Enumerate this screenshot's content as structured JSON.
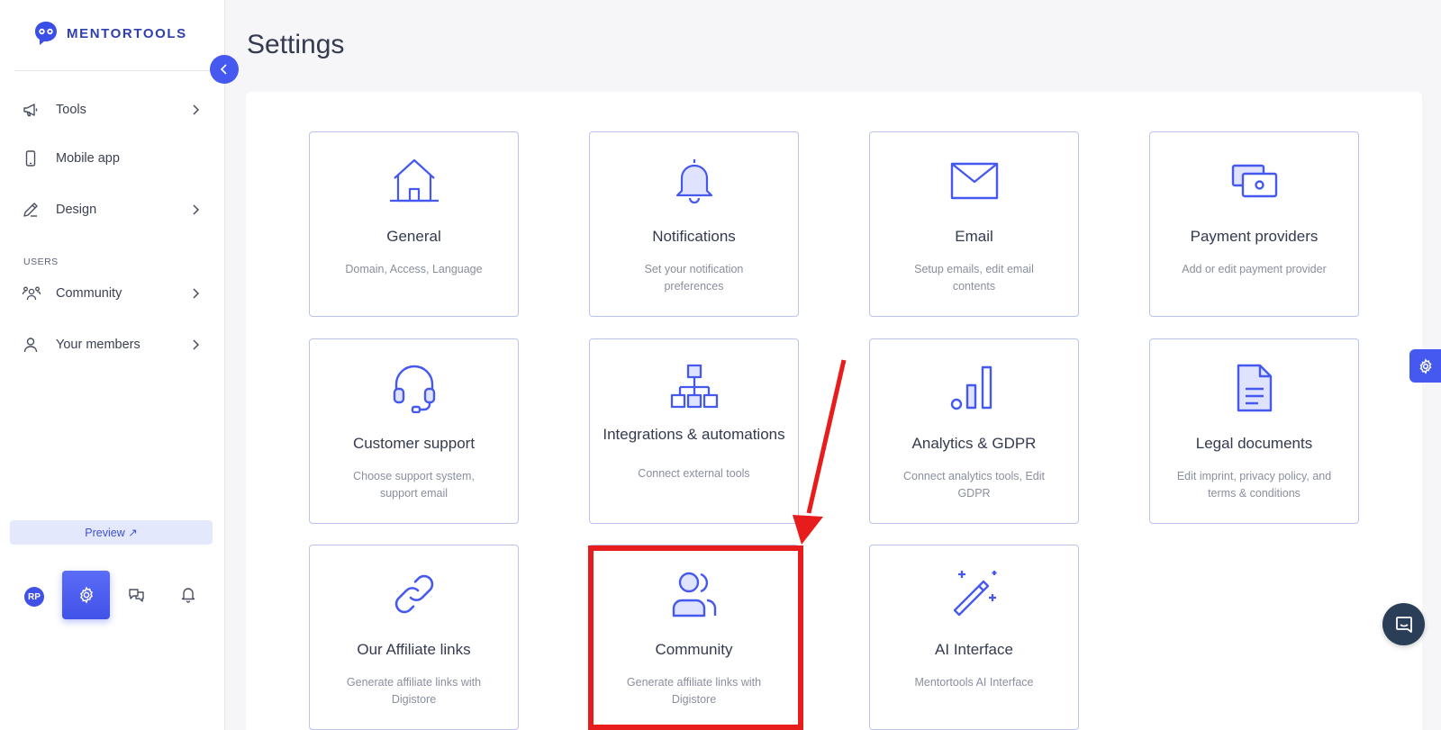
{
  "brand": {
    "name": "MENTORTOOLS"
  },
  "sidebar": {
    "items": [
      {
        "label": "Tools",
        "icon": "megaphone-icon",
        "chevron": true
      },
      {
        "label": "Mobile app",
        "icon": "phone-icon",
        "chevron": false
      },
      {
        "label": "Design",
        "icon": "pencil-icon",
        "chevron": true
      },
      {
        "label": "Community",
        "icon": "people-icon",
        "chevron": true
      },
      {
        "label": "Your members",
        "icon": "user-icon",
        "chevron": true
      }
    ],
    "section_users": "USERS",
    "preview_label": "Preview ↗",
    "avatar_initials": "RP"
  },
  "page": {
    "title": "Settings"
  },
  "cards": [
    {
      "title": "General",
      "desc": "Domain, Access, Language",
      "icon": "home-icon"
    },
    {
      "title": "Notifications",
      "desc": "Set your notification preferences",
      "icon": "bell-icon"
    },
    {
      "title": "Email",
      "desc": "Setup emails, edit email contents",
      "icon": "envelope-icon"
    },
    {
      "title": "Payment providers",
      "desc": "Add or edit payment provider",
      "icon": "payment-icon"
    },
    {
      "title": "Customer support",
      "desc": "Choose support system, support email",
      "icon": "headset-icon"
    },
    {
      "title": "Integrations & automations",
      "desc": "Connect external tools",
      "icon": "hierarchy-icon"
    },
    {
      "title": "Analytics & GDPR",
      "desc": "Connect analytics tools, Edit GDPR",
      "icon": "bar-chart-icon"
    },
    {
      "title": "Legal documents",
      "desc": "Edit imprint, privacy policy, and terms & conditions",
      "icon": "document-icon"
    },
    {
      "title": "Our Affiliate links",
      "desc": "Generate affiliate links with Digistore",
      "icon": "link-icon"
    },
    {
      "title": "Community",
      "desc": "Generate affiliate links with Digistore",
      "icon": "community-icon"
    },
    {
      "title": "AI Interface",
      "desc": "Mentortools AI Interface",
      "icon": "magic-wand-icon"
    }
  ],
  "colors": {
    "accent": "#4559f0",
    "highlight": "#e71d1d",
    "card_border": "#bcc2ee"
  }
}
